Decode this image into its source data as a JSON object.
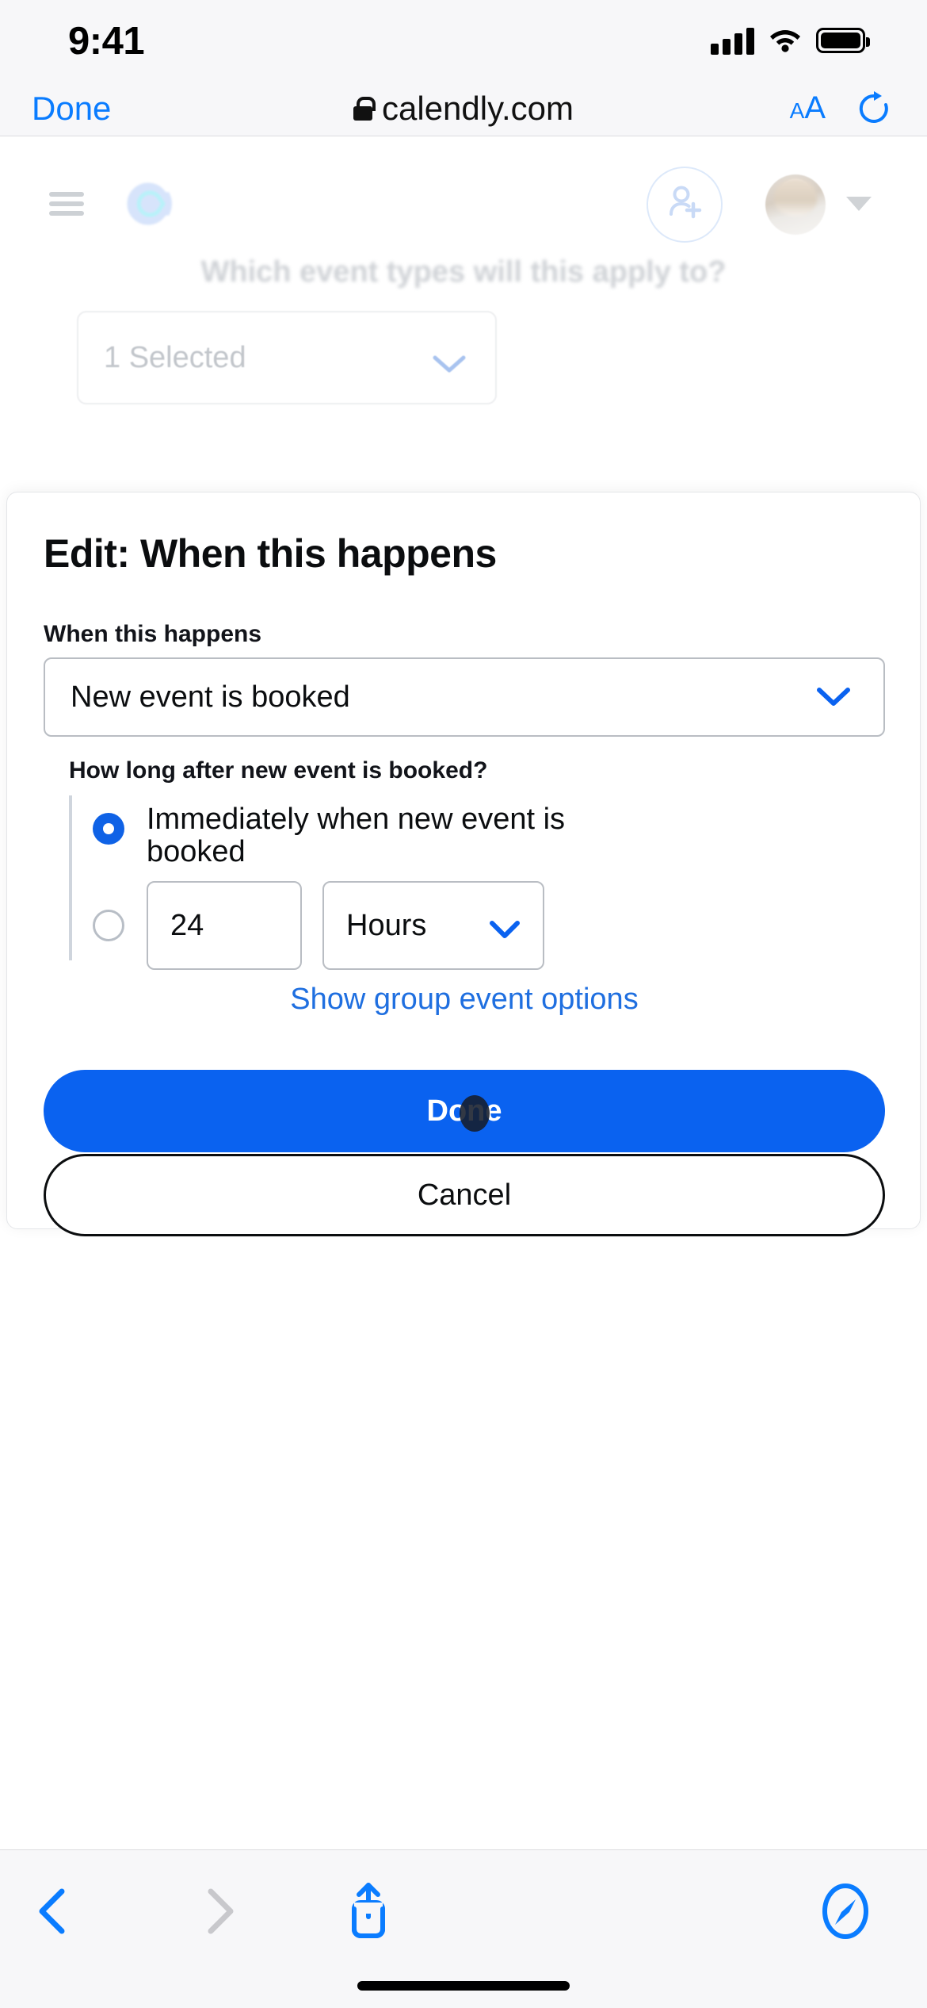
{
  "status_bar": {
    "time": "9:41",
    "signal_icon": "cellular-signal-icon",
    "wifi_icon": "wifi-icon",
    "battery_icon": "battery-icon"
  },
  "browser": {
    "done_label": "Done",
    "url": "calendly.com",
    "lock_icon": "lock-icon",
    "text_size_small": "A",
    "text_size_large": "A",
    "reload_icon": "reload-icon",
    "bottom": {
      "back_icon": "chevron-left-icon",
      "forward_icon": "chevron-right-icon",
      "share_icon": "share-icon",
      "tabs_icon": "safari-compass-icon"
    }
  },
  "page_background": {
    "menu_icon": "hamburger-menu-icon",
    "logo_icon": "calendly-logo-icon",
    "invite_icon": "add-person-icon",
    "avatar_icon": "user-avatar",
    "account_caret_icon": "caret-down-icon",
    "question": "Which event types will this apply to?",
    "event_types_value": "1 Selected",
    "event_types_caret": "chevron-down-icon"
  },
  "modal": {
    "title": "Edit: When this happens",
    "when_label": "When this happens",
    "when_value": "New event is booked",
    "when_caret": "chevron-down-icon",
    "howlong_label": "How long after new event is booked?",
    "radio_immediate_label": "Immediately when new event is booked",
    "radio_immediate_selected": true,
    "delay_amount": "24",
    "delay_unit": "Hours",
    "delay_unit_caret": "chevron-down-icon",
    "group_options_link": "Show group event options",
    "done_label": "Done",
    "cancel_label": "Cancel",
    "tap_indicator": "touch-point-indicator"
  },
  "colors": {
    "accent_blue": "#0a62f0",
    "link_blue": "#1f6fe0",
    "ios_blue": "#0a7cff",
    "chrome_bg": "#f7f7f9",
    "border_gray": "#b9bdc3"
  }
}
